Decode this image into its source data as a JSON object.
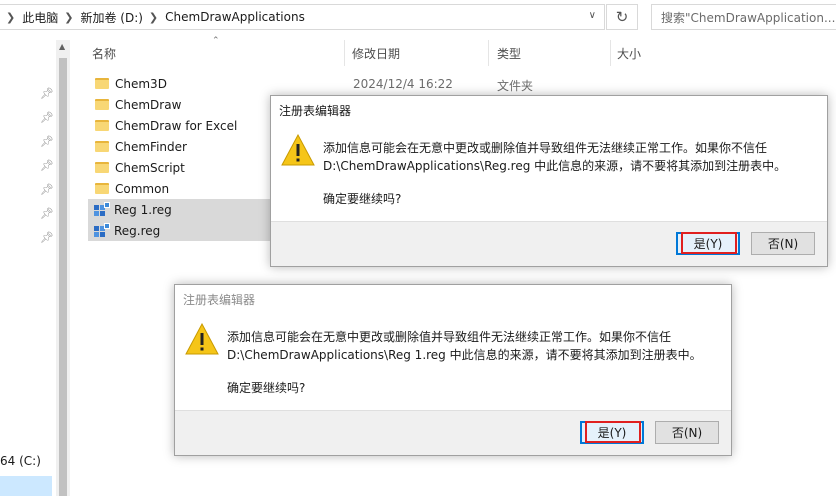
{
  "address_bar": {
    "crumbs": [
      "此电脑",
      "新加卷 (D:)",
      "ChemDrawApplications"
    ],
    "search_placeholder": "搜索\"ChemDrawApplication..."
  },
  "columns": {
    "name": "名称",
    "modified": "修改日期",
    "type": "类型",
    "size": "大小"
  },
  "files": [
    {
      "name": "Chem3D",
      "kind": "folder",
      "modified": "2024/12/4 16:22",
      "type": "文件夹"
    },
    {
      "name": "ChemDraw",
      "kind": "folder"
    },
    {
      "name": "ChemDraw for Excel",
      "kind": "folder"
    },
    {
      "name": "ChemFinder",
      "kind": "folder"
    },
    {
      "name": "ChemScript",
      "kind": "folder"
    },
    {
      "name": "Common",
      "kind": "folder"
    },
    {
      "name": "Reg 1.reg",
      "kind": "reg"
    },
    {
      "name": "Reg.reg",
      "kind": "reg"
    }
  ],
  "nav": {
    "drive_label": "64 (C:)"
  },
  "dialog_top": {
    "title": "注册表编辑器",
    "line1": "添加信息可能会在无意中更改或删除值并导致组件无法继续正常工作。如果你不信任",
    "line2": "D:\\ChemDrawApplications\\Reg.reg 中此信息的来源，请不要将其添加到注册表中。",
    "question": "确定要继续吗?",
    "yes": "是(Y)",
    "no": "否(N)"
  },
  "dialog_bottom": {
    "title": "注册表编辑器",
    "line1": "添加信息可能会在无意中更改或删除值并导致组件无法继续正常工作。如果你不信任",
    "line2": "D:\\ChemDrawApplications\\Reg 1.reg 中此信息的来源，请不要将其添加到注册表中。",
    "question": "确定要继续吗?",
    "yes": "是(Y)",
    "no": "否(N)"
  },
  "colors": {
    "highlight_red": "#e02020",
    "focus_blue": "#0078d7",
    "warning_yellow": "#f5c518"
  }
}
